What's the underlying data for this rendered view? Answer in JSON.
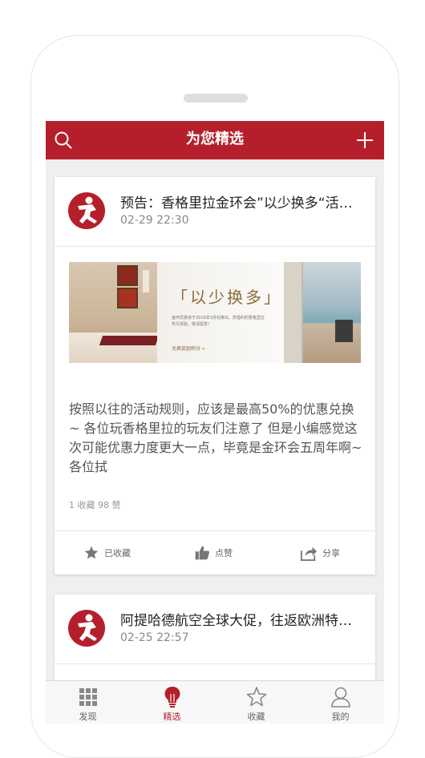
{
  "header": {
    "title": "为您精选"
  },
  "posts": [
    {
      "title": "预告：香格里拉金环会”以少换多“活动开启",
      "time": "02-29 22:30",
      "banner": {
        "slogan": "「以少换多」",
        "small_text": "金环优惠将于2016年3月初推出，赏福利的香格里拉杯凡体验，敬请留意！",
        "link_text": "兑换奖励积分 »"
      },
      "body": "按照以往的活动规则，应该是最高50%的优惠兑换~ 各位玩香格里拉的玩友们注意了 但是小编感觉这次可能优惠力度更大一点，毕竟是金环会五周年啊~ 各位拭",
      "stats": "1 收藏   98 赞",
      "actions": {
        "collected": "已收藏",
        "like": "点赞",
        "share": "分享"
      }
    },
    {
      "title": "阿提哈德航空全球大促，往返欧洲特价机票",
      "time": "02-25 22:57"
    }
  ],
  "tabs": [
    {
      "label": "发现",
      "icon": "grid-icon"
    },
    {
      "label": "精选",
      "icon": "lightbulb-icon"
    },
    {
      "label": "收藏",
      "icon": "star-icon"
    },
    {
      "label": "我的",
      "icon": "user-icon"
    }
  ],
  "colors": {
    "brand": "#b51f2c",
    "background": "#efefef"
  }
}
